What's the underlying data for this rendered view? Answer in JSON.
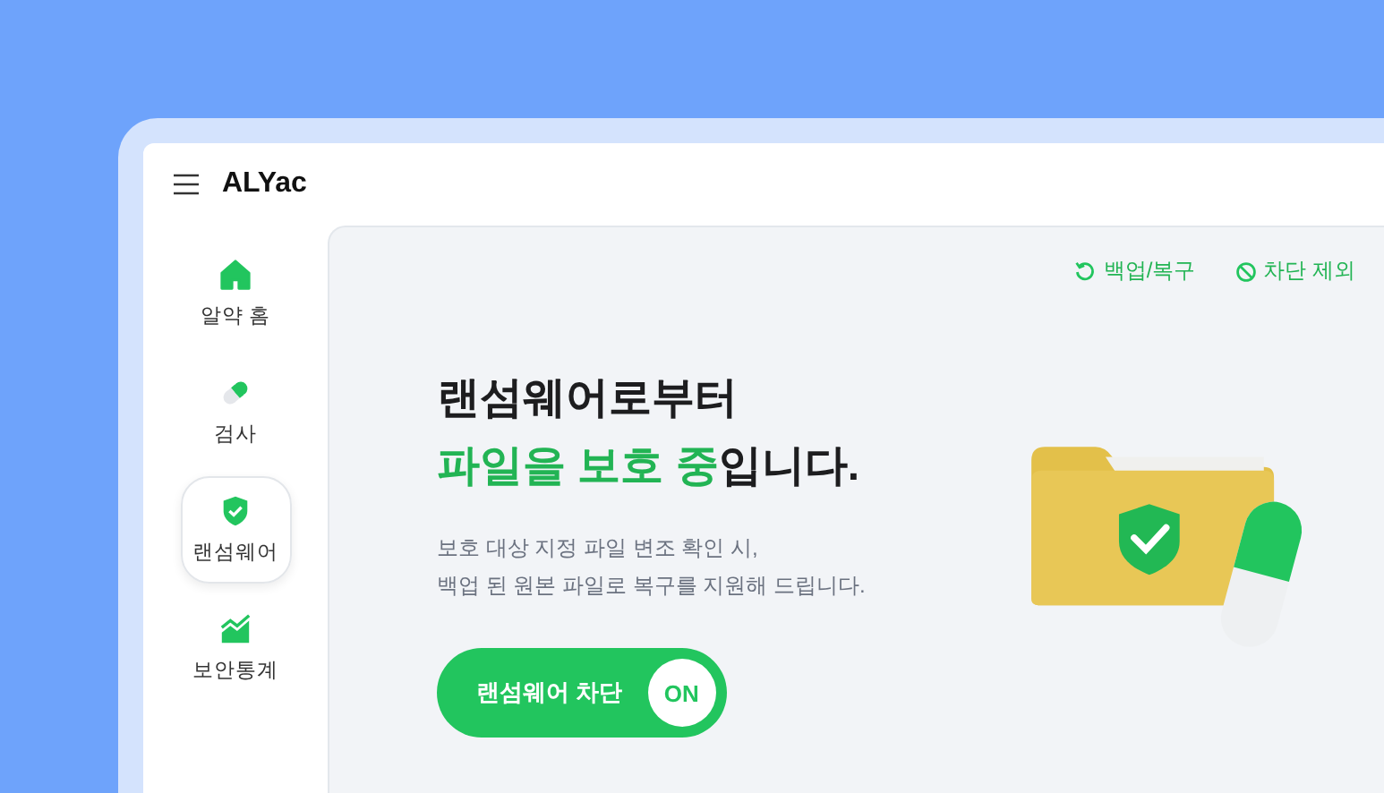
{
  "app": {
    "title": "ALYac"
  },
  "sidebar": {
    "items": [
      {
        "label": "알약 홈",
        "kind": "home",
        "selected": false
      },
      {
        "label": "검사",
        "kind": "pill",
        "selected": false
      },
      {
        "label": "랜섬웨어",
        "kind": "shield",
        "selected": true
      },
      {
        "label": "보안통계",
        "kind": "chart",
        "selected": false
      }
    ]
  },
  "actions": [
    {
      "label": "백업/복구",
      "kind": "restore"
    },
    {
      "label": "차단 제외",
      "kind": "block"
    }
  ],
  "headline": [
    [
      {
        "text": "랜섬웨어로부터",
        "highlight": false
      }
    ],
    [
      {
        "text": "파일을 보호 중",
        "highlight": true
      },
      {
        "text": "입니다.",
        "highlight": false
      }
    ]
  ],
  "description": [
    "보호 대상 지정 파일 변조 확인 시,",
    "백업 된 원본 파일로 복구를 지원해 드립니다."
  ],
  "toggle": {
    "label": "랜섬웨어 차단",
    "state": "ON",
    "on": true
  }
}
